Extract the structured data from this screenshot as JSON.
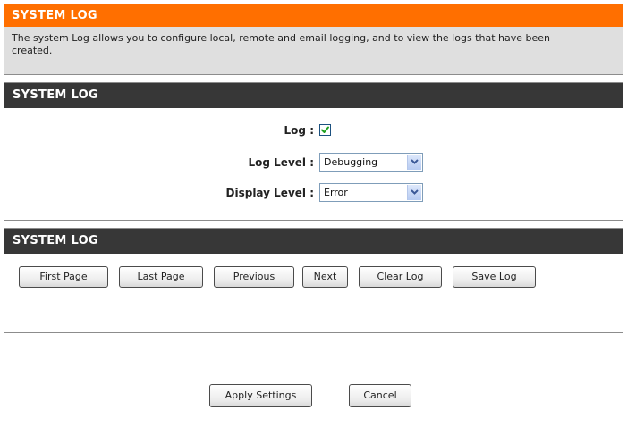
{
  "intro": {
    "title": "SYSTEM LOG",
    "description": "The system Log allows you to configure local, remote and email logging, and to view the logs that have been\ncreated."
  },
  "settings": {
    "title": "SYSTEM LOG",
    "log": {
      "label": "Log :",
      "checked": true
    },
    "log_level": {
      "label": "Log Level :",
      "value": "Debugging"
    },
    "display_level": {
      "label": "Display Level :",
      "value": "Error"
    }
  },
  "log_section": {
    "title": "SYSTEM LOG",
    "buttons": {
      "first_page": "First Page",
      "last_page": "Last Page",
      "previous": "Previous",
      "next": "Next",
      "clear_log": "Clear Log",
      "save_log": "Save Log"
    }
  },
  "footer": {
    "apply": "Apply Settings",
    "cancel": "Cancel"
  },
  "colors": {
    "accent_orange": "#ff6f00",
    "section_header": "#373737",
    "intro_bg": "#dfdfdf",
    "checkmark": "#21a121"
  },
  "icons": {
    "checkbox_check": "checkmark-icon",
    "dropdown_arrow": "chevron-down-icon"
  }
}
